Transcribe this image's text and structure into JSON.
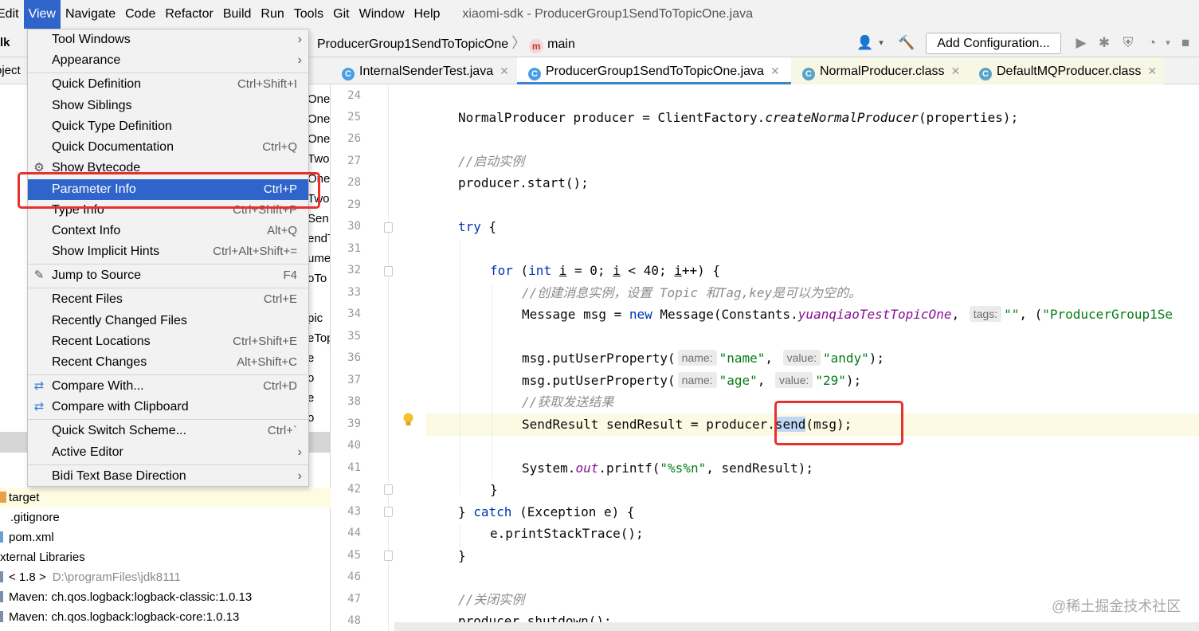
{
  "menubar": {
    "items": [
      "Edit",
      "View",
      "Navigate",
      "Code",
      "Refactor",
      "Build",
      "Run",
      "Tools",
      "Git",
      "Window",
      "Help"
    ],
    "active_index": 1,
    "window_title": "xiaomi-sdk - ProducerGroup1SendToTopicOne.java"
  },
  "navbar": {
    "project_fragment": "lk",
    "crumb_file": "ProducerGroup1SendToTopicOne",
    "crumb_method": "main",
    "add_configuration": "Add Configuration..."
  },
  "project_panel": {
    "header": "oject",
    "peek_lines": [
      "One",
      "One",
      "Onel",
      "Two",
      "One",
      "Two",
      "Sen",
      "endT",
      "ume",
      "oTo",
      "",
      "pic",
      "eTop",
      "e",
      "o",
      "e",
      "o"
    ],
    "tree": [
      {
        "label": "target",
        "muted": ""
      },
      {
        "label": ".gitignore",
        "muted": ""
      },
      {
        "label": "pom.xml",
        "muted": ""
      },
      {
        "label": "xternal Libraries",
        "muted": ""
      },
      {
        "label": "< 1.8 >",
        "muted": "D:\\programFiles\\jdk8111"
      },
      {
        "label": "Maven: ch.qos.logback:logback-classic:1.0.13",
        "muted": ""
      },
      {
        "label": "Maven: ch.qos.logback:logback-core:1.0.13",
        "muted": ""
      }
    ]
  },
  "tabs": [
    {
      "label": "InternalSenderTest.java",
      "close": "✕"
    },
    {
      "label": "ProducerGroup1SendToTopicOne.java",
      "close": "✕"
    },
    {
      "label": "NormalProducer.class",
      "close": "✕"
    },
    {
      "label": "DefaultMQProducer.class",
      "close": "✕"
    }
  ],
  "line_numbers": [
    "24",
    "25",
    "26",
    "27",
    "28",
    "29",
    "30",
    "31",
    "32",
    "33",
    "34",
    "35",
    "36",
    "37",
    "38",
    "39",
    "40",
    "41",
    "42",
    "43",
    "44",
    "45",
    "46",
    "47",
    "48"
  ],
  "code": {
    "l25_a": "NormalProducer producer = ClientFactory.",
    "l25_b": "createNormalProducer",
    "l25_c": "(properties);",
    "l27": "//启动实例",
    "l28": "producer.start();",
    "l30_kw": "try",
    "l30_b": " {",
    "l32_for": "for",
    "l32_b": " (",
    "l32_int": "int",
    "l32_sp": " ",
    "l32_i1": "i",
    "l32_c": " = 0; ",
    "l32_i2": "i",
    "l32_d": " < 40; ",
    "l32_i3": "i",
    "l32_e": "++) {",
    "l33": "//创建消息实例，设置 Topic 和Tag,key是可以为空的。",
    "l34_a": "Message msg = ",
    "l34_new": "new",
    "l34_b": " Message(Constants.",
    "l34_c": "yuanqiaoTestTopicOne",
    "l34_d": ", ",
    "l34_hint": "tags:",
    "l34_e": "\"\"",
    "l34_f": ", (",
    "l34_g": "\"ProducerGroup1Se",
    "l36_a": "msg.putUserProperty(",
    "l36_h1": "name:",
    "l36_s1": "\"name\"",
    "l36_b": ", ",
    "l36_h2": "value:",
    "l36_s2": "\"andy\"",
    "l36_c": ");",
    "l37_a": "msg.putUserProperty(",
    "l37_h1": "name:",
    "l37_s1": "\"age\"",
    "l37_b": ", ",
    "l37_h2": "value:",
    "l37_s2": "\"29\"",
    "l37_c": ");",
    "l38": "//获取发送结果",
    "l39_a": "SendResult sendResult = producer.",
    "l39_send": "send",
    "l39_b": "(msg);",
    "l41_a": "System.",
    "l41_out": "out",
    "l41_b": ".printf(",
    "l41_s": "\"%s%n\"",
    "l41_c": ", sendResult);",
    "l42": "}",
    "l43_a": "} ",
    "l43_catch": "catch",
    "l43_b": " (Exception e) {",
    "l44": "e.printStackTrace();",
    "l45": "}",
    "l47": "//关闭实例",
    "l48": "producer.shutdown();"
  },
  "view_menu": {
    "items": [
      {
        "label": "Tool Windows",
        "shortcut": "",
        "submenu": true
      },
      {
        "label": "Appearance",
        "shortcut": "",
        "submenu": true
      },
      {
        "label": "Quick Definition",
        "shortcut": "Ctrl+Shift+I"
      },
      {
        "label": "Show Siblings",
        "shortcut": ""
      },
      {
        "label": "Quick Type Definition",
        "shortcut": ""
      },
      {
        "label": "Quick Documentation",
        "shortcut": "Ctrl+Q"
      },
      {
        "label": "Show Bytecode",
        "shortcut": ""
      },
      {
        "label": "Parameter Info",
        "shortcut": "Ctrl+P"
      },
      {
        "label": "Type Info",
        "shortcut": "Ctrl+Shift+P"
      },
      {
        "label": "Context Info",
        "shortcut": "Alt+Q"
      },
      {
        "label": "Show Implicit Hints",
        "shortcut": "Ctrl+Alt+Shift+="
      },
      {
        "label": "Jump to Source",
        "shortcut": "F4"
      },
      {
        "label": "Recent Files",
        "shortcut": "Ctrl+E"
      },
      {
        "label": "Recently Changed Files",
        "shortcut": ""
      },
      {
        "label": "Recent Locations",
        "shortcut": "Ctrl+Shift+E"
      },
      {
        "label": "Recent Changes",
        "shortcut": "Alt+Shift+C"
      },
      {
        "label": "Compare With...",
        "shortcut": "Ctrl+D"
      },
      {
        "label": "Compare with Clipboard",
        "shortcut": ""
      },
      {
        "label": "Quick Switch Scheme...",
        "shortcut": "Ctrl+`"
      },
      {
        "label": "Active Editor",
        "shortcut": "",
        "submenu": true
      },
      {
        "label": "Bidi Text Base Direction",
        "shortcut": "",
        "submenu": true
      }
    ],
    "submenu_arrow": "›",
    "selected_index": 7
  },
  "watermark": "@稀土掘金技术社区",
  "colors": {
    "menu_selection": "#2f65ca",
    "highlight_box": "#e8302c",
    "keyword": "#0033b3",
    "string": "#067d17",
    "comment": "#8c8c8c"
  }
}
